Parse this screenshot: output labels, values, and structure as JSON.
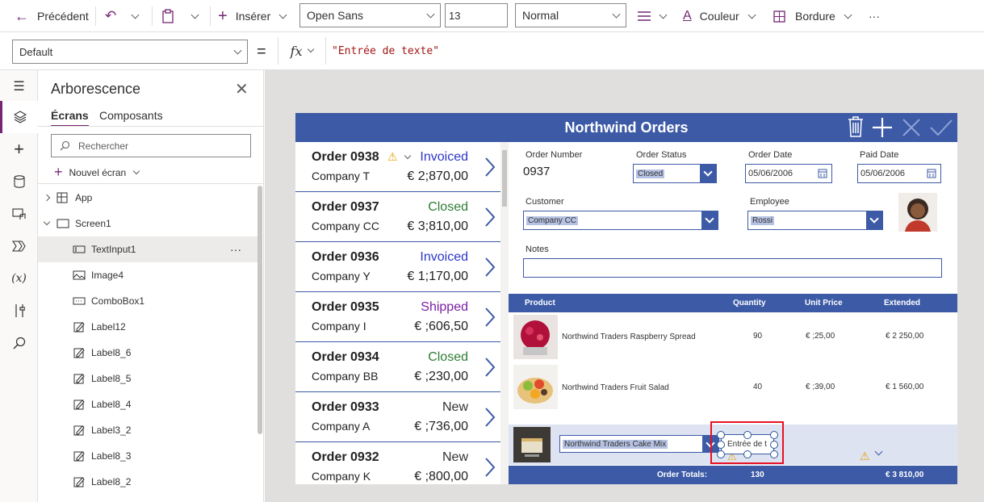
{
  "toolbar": {
    "back_label": "Précédent",
    "insert_label": "Insérer",
    "font_value": "Open Sans",
    "size_value": "13",
    "weight_value": "Normal",
    "color_label": "Couleur",
    "border_label": "Bordure",
    "more_label": "···"
  },
  "formula": {
    "property_value": "Default",
    "equals": "=",
    "fx": "fx",
    "expression": "\"Entrée de texte\""
  },
  "tree": {
    "title": "Arborescence",
    "tab_screens": "Écrans",
    "tab_components": "Composants",
    "search_placeholder": "Rechercher",
    "new_screen": "Nouvel écran",
    "items": [
      {
        "label": "App"
      },
      {
        "label": "Screen1"
      },
      {
        "label": "TextInput1"
      },
      {
        "label": "Image4"
      },
      {
        "label": "ComboBox1"
      },
      {
        "label": "Label12"
      },
      {
        "label": "Label8_6"
      },
      {
        "label": "Label8_5"
      },
      {
        "label": "Label8_4"
      },
      {
        "label": "Label3_2"
      },
      {
        "label": "Label8_3"
      },
      {
        "label": "Label8_2"
      }
    ],
    "more": "···"
  },
  "app": {
    "title": "Northwind Orders",
    "orders": [
      {
        "order": "Order 0938",
        "company": "Company T",
        "status": "Invoiced",
        "amount": "€ 2;870,00",
        "status_color": "#2b35c8"
      },
      {
        "order": "Order 0937",
        "company": "Company CC",
        "status": "Closed",
        "amount": "€ 3;810,00",
        "status_color": "#2e7d32"
      },
      {
        "order": "Order 0936",
        "company": "Company Y",
        "status": "Invoiced",
        "amount": "€ 1;170,00",
        "status_color": "#2b35c8"
      },
      {
        "order": "Order 0935",
        "company": "Company I",
        "status": "Shipped",
        "amount": "€ ;606,50",
        "status_color": "#7b1fa2"
      },
      {
        "order": "Order 0934",
        "company": "Company BB",
        "status": "Closed",
        "amount": "€ ;230,00",
        "status_color": "#2e7d32"
      },
      {
        "order": "Order 0933",
        "company": "Company A",
        "status": "New",
        "amount": "€ ;736,00",
        "status_color": "#323130"
      },
      {
        "order": "Order 0932",
        "company": "Company K",
        "status": "New",
        "amount": "€ ;800,00",
        "status_color": "#323130"
      }
    ],
    "detail": {
      "order_number_label": "Order Number",
      "order_number": "0937",
      "order_status_label": "Order Status",
      "order_status": "Closed",
      "order_date_label": "Order Date",
      "order_date": "05/06/2006",
      "paid_date_label": "Paid Date",
      "paid_date": "05/06/2006",
      "customer_label": "Customer",
      "customer": "Company CC",
      "employee_label": "Employee",
      "employee": "Rossi",
      "notes_label": "Notes"
    },
    "products_header": {
      "product": "Product",
      "quantity": "Quantity",
      "unit_price": "Unit Price",
      "extended": "Extended"
    },
    "products": [
      {
        "name": "Northwind Traders Raspberry Spread",
        "quantity": "90",
        "unit_price": "€ ;25,00",
        "extended": "€ 2 250,00"
      },
      {
        "name": "Northwind Traders Fruit Salad",
        "quantity": "40",
        "unit_price": "€ ;39,00",
        "extended": "€ 1 560,00"
      }
    ],
    "new_row": {
      "product": "Northwind Traders Cake Mix",
      "text_input": "Entrée de t"
    },
    "totals": {
      "label": "Order Totals:",
      "quantity": "130",
      "extended": "€ 3 810,00"
    }
  },
  "colors": {
    "app_blue": "#3c5aa6",
    "selection_red": "#e81123",
    "accent_purple": "#742774"
  }
}
